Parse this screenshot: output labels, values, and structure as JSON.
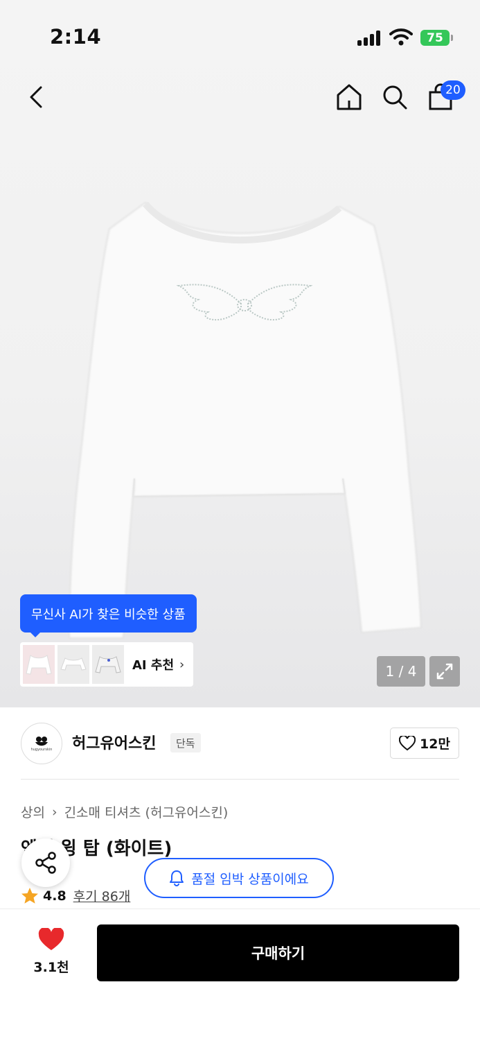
{
  "status_bar": {
    "time": "2:14",
    "battery": "75"
  },
  "header": {
    "cart_count": "20"
  },
  "gallery": {
    "pager": "1 / 4"
  },
  "ai": {
    "bubble": "무신사 AI가 찾은 비슷한 상품",
    "label": "AI 추천",
    "chevron": "›"
  },
  "brand": {
    "name": "허그유어스킨",
    "tag": "단독",
    "logo_text": "hugyourskin",
    "likes": "12만"
  },
  "breadcrumb": {
    "category": "상의",
    "separator": "›",
    "subcategory": "긴소매 티셔츠 (허그유어스킨)"
  },
  "product": {
    "title": "엔젤 윙 탑 (화이트)",
    "rating": "4.8",
    "reviews": "후기 86개"
  },
  "notice": {
    "soldout": "품절 임박 상품이에요"
  },
  "bottom": {
    "wish_count": "3.1천",
    "buy_label": "구매하기"
  },
  "colors": {
    "accent": "#1f5eff",
    "heart": "#e8292c",
    "star": "#f5a524",
    "buy": "#000000"
  }
}
